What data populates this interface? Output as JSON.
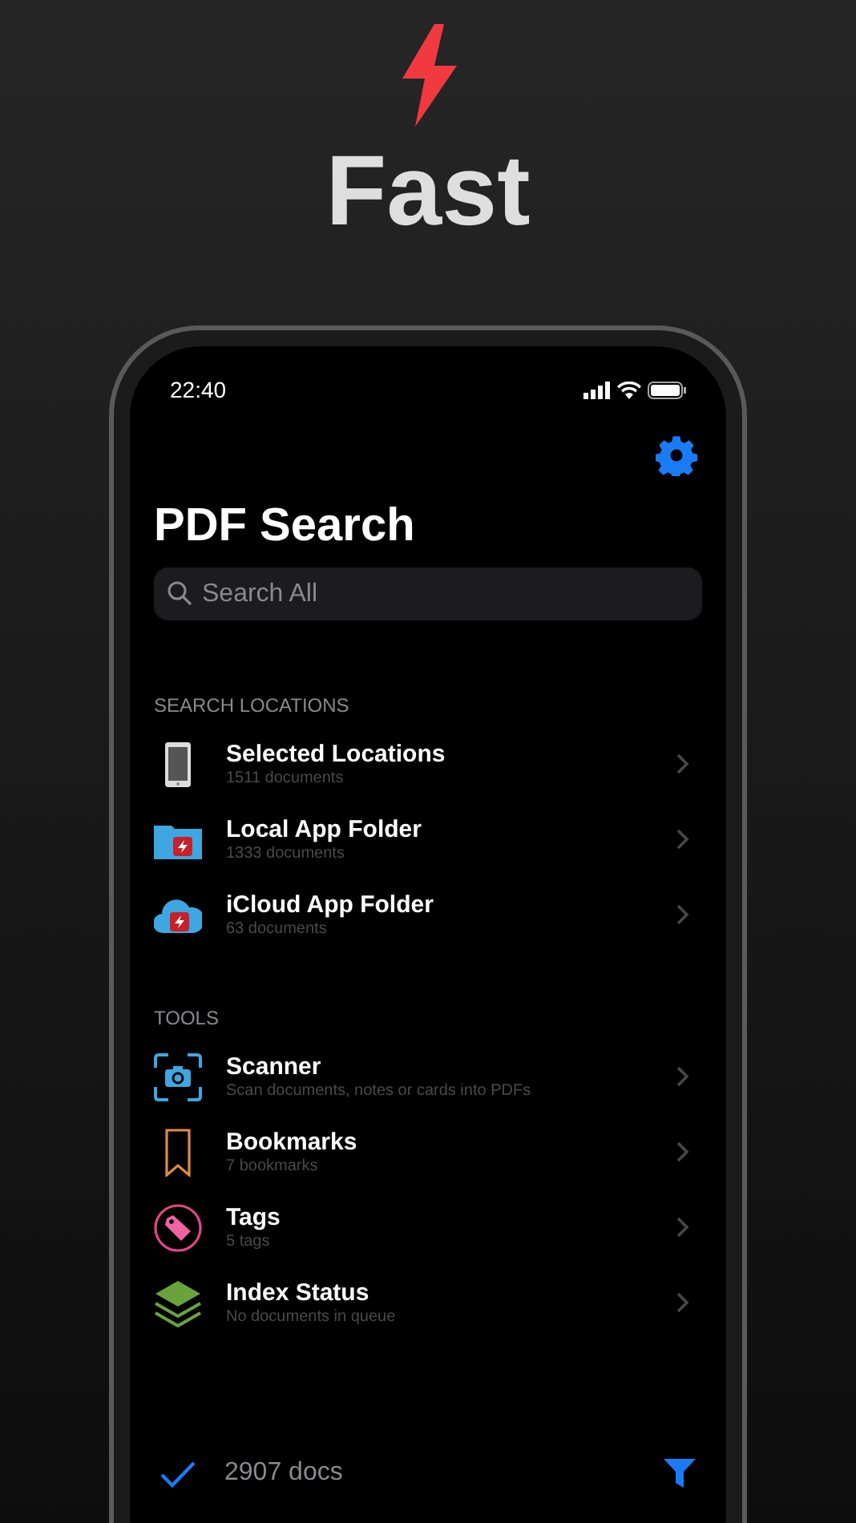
{
  "headline": "Fast",
  "status_bar": {
    "time": "22:40"
  },
  "title": "PDF Search",
  "search": {
    "placeholder": "Search All"
  },
  "sections": [
    {
      "header": "SEARCH LOCATIONS",
      "rows": [
        {
          "kind": "device",
          "title": "Selected Locations",
          "subtitle": "1511 documents"
        },
        {
          "kind": "folder",
          "title": "Local App Folder",
          "subtitle": "1333 documents"
        },
        {
          "kind": "cloud",
          "title": "iCloud App Folder",
          "subtitle": "63 documents"
        }
      ]
    },
    {
      "header": "TOOLS",
      "rows": [
        {
          "kind": "scanner",
          "title": "Scanner",
          "subtitle": "Scan documents, notes or cards into PDFs"
        },
        {
          "kind": "bookmark",
          "title": "Bookmarks",
          "subtitle": "7 bookmarks"
        },
        {
          "kind": "tag",
          "title": "Tags",
          "subtitle": "5 tags"
        },
        {
          "kind": "layers",
          "title": "Index Status",
          "subtitle": "No documents in queue"
        }
      ]
    }
  ],
  "toolbar": {
    "count": "2907 docs"
  }
}
